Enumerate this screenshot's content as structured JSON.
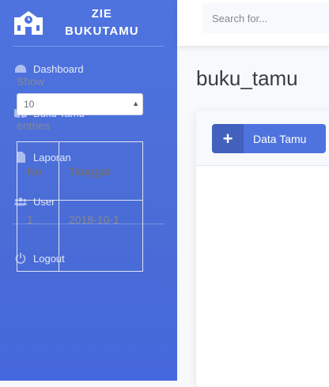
{
  "brand": {
    "line1": "ZIE",
    "line2": "BUKUTAMU",
    "icon": "school-icon"
  },
  "sidebar": {
    "items": [
      {
        "label": "Dashboard",
        "icon": "tachometer-icon"
      },
      {
        "label": "Buku Tamu",
        "icon": "book-icon"
      },
      {
        "label": "Laporan",
        "icon": "file-icon"
      },
      {
        "label": "User",
        "icon": "users-icon"
      }
    ],
    "logout": {
      "label": "Logout",
      "icon": "power-icon"
    }
  },
  "topbar": {
    "search_placeholder": "Search for..."
  },
  "page": {
    "title": "buku_tamu"
  },
  "card": {
    "add_button_label": "Data Tamu",
    "show_label": "Show",
    "entries_value": "10",
    "entries_label": "entries",
    "table": {
      "headers": [
        "No",
        "Tanggal"
      ],
      "rows": [
        {
          "no": "1",
          "tanggal": "2018-10-1"
        }
      ]
    }
  },
  "colors": {
    "primary": "#4e73df",
    "background": "#f8f9fc",
    "text_muted": "#858796"
  }
}
